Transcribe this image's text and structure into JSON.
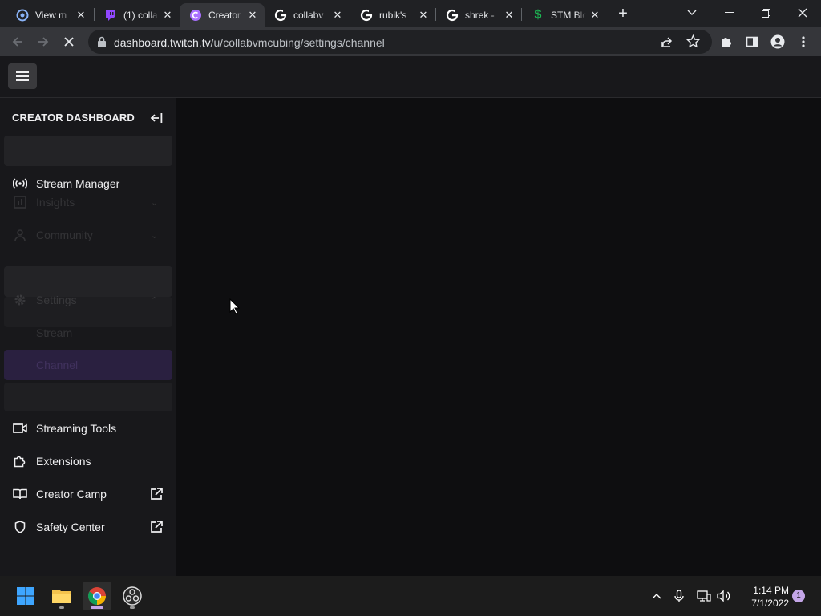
{
  "browser": {
    "tabs": [
      {
        "title": "View m",
        "icon": "chrome-settings-icon"
      },
      {
        "title": "(1) colla",
        "icon": "twitch-icon"
      },
      {
        "title": "Creator",
        "icon": "twitch-dashboard-icon"
      },
      {
        "title": "collabv",
        "icon": "google-icon"
      },
      {
        "title": "rubik's",
        "icon": "google-icon"
      },
      {
        "title": "shrek -",
        "icon": "google-icon"
      },
      {
        "title": "STM Blo",
        "icon": "dollar-icon"
      }
    ],
    "active_tab": 2,
    "url_host": "dashboard.twitch.tv",
    "url_path": "/u/collabvmcubing/settings/channel"
  },
  "sidebar": {
    "title": "CREATOR DASHBOARD",
    "items": [
      {
        "label": "Stream Manager",
        "icon": "broadcast-icon"
      },
      {
        "label": "Insights",
        "icon": "insights-icon"
      },
      {
        "label": "Community",
        "icon": "community-icon"
      },
      {
        "label": "Settings",
        "icon": "gear-icon"
      },
      {
        "label": "Stream"
      },
      {
        "label": "Channel"
      },
      {
        "label": "Streaming Tools",
        "icon": "camera-icon"
      },
      {
        "label": "Extensions",
        "icon": "puzzle-icon"
      },
      {
        "label": "Creator Camp",
        "icon": "book-icon"
      },
      {
        "label": "Safety Center",
        "icon": "shield-icon"
      }
    ]
  },
  "taskbar": {
    "time": "1:14 PM",
    "date": "7/1/2022",
    "notifications": "1"
  },
  "colors": {
    "accent": "#772ce8",
    "background": "#0e0e10",
    "sidebar": "#18181b"
  }
}
